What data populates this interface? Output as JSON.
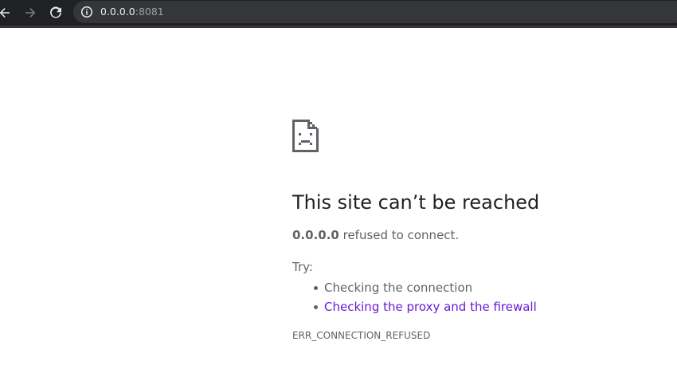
{
  "browser": {
    "url_host": "0.0.0.0",
    "url_port": ":8081"
  },
  "error_page": {
    "heading": "This site can’t be reached",
    "host": "0.0.0.0",
    "message_suffix": " refused to connect.",
    "try_label": "Try:",
    "suggestions": [
      "Checking the connection",
      "Checking the proxy and the firewall"
    ],
    "error_code": "ERR_CONNECTION_REFUSED"
  },
  "colors": {
    "toolbar_bg": "#202124",
    "omnibox_bg": "#35363a",
    "heading": "#202124",
    "body_text": "#5f6368",
    "link": "#6b19d6"
  },
  "icons": [
    "back-icon",
    "forward-icon",
    "reload-icon",
    "info-icon",
    "sad-page-icon"
  ]
}
